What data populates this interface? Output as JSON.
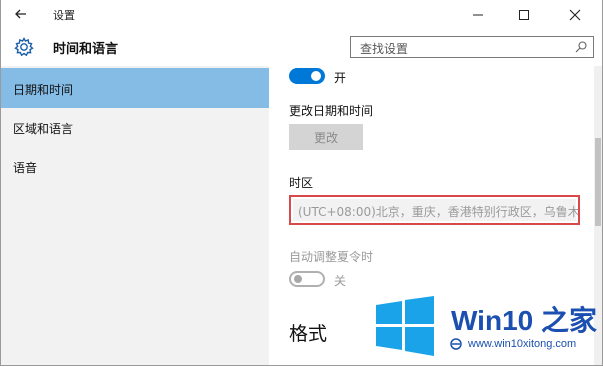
{
  "titlebar": {
    "title": "设置"
  },
  "header": {
    "title": "时间和语言",
    "search_placeholder": "查找设置"
  },
  "sidebar": {
    "items": [
      {
        "label": "日期和时间",
        "active": true
      },
      {
        "label": "区域和语言",
        "active": false
      },
      {
        "label": "语音",
        "active": false
      }
    ]
  },
  "content": {
    "auto_time_toggle": {
      "state": "on",
      "label": "开"
    },
    "change_datetime_label": "更改日期和时间",
    "change_button_label": "更改",
    "timezone_label": "时区",
    "timezone_value": "(UTC+08:00)北京，重庆，香港特别行政区，乌鲁木",
    "dst_label": "自动调整夏令时",
    "dst_toggle": {
      "state": "off",
      "label": "关"
    },
    "format_heading": "格式"
  },
  "watermark": {
    "brand": "Win10 之家",
    "url": "www.win10xitong.com"
  },
  "colors": {
    "accent": "#0078d7",
    "sidebar_active": "#84bce6",
    "sidebar_bg": "#f2f2f2",
    "highlight_border": "#d84a4a",
    "watermark_blue": "#1b4fb0"
  }
}
